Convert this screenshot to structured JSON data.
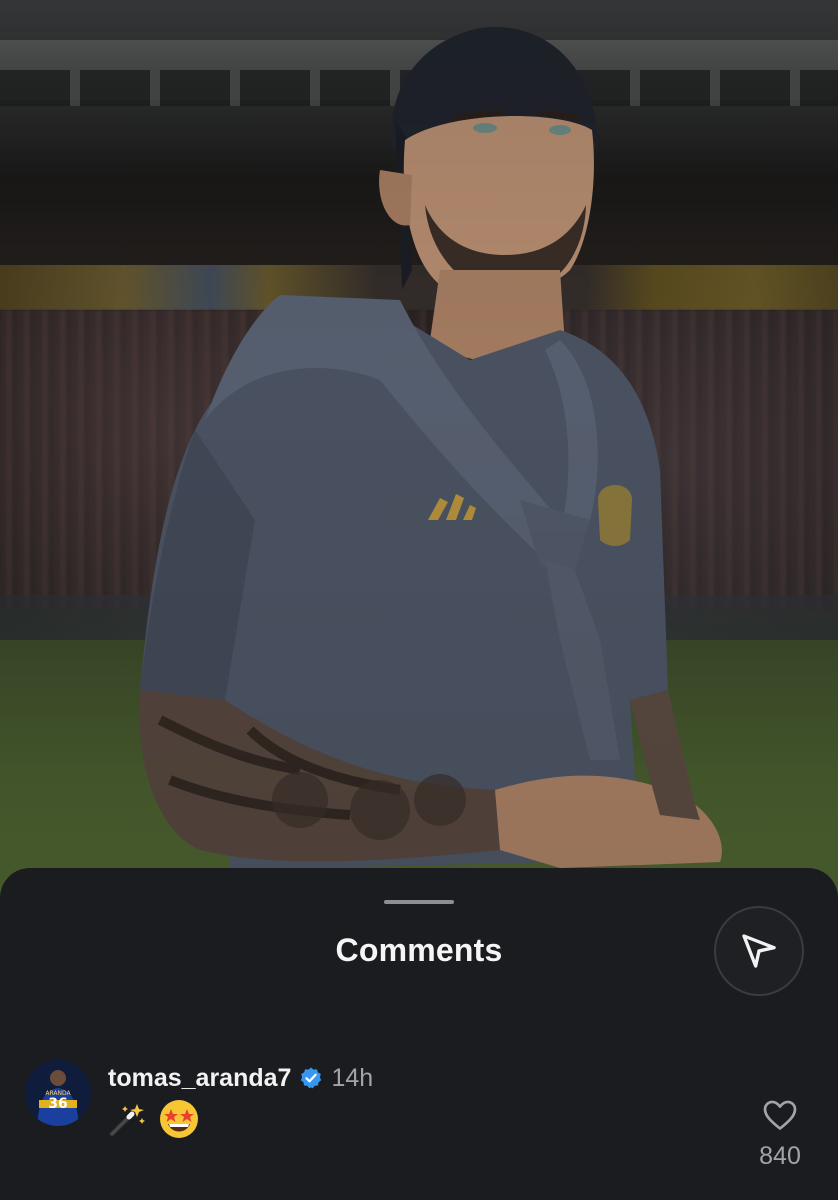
{
  "comments_sheet": {
    "title": "Comments",
    "share_icon": "send-paper-plane-icon"
  },
  "comment": {
    "username": "tomas_aranda7",
    "verified": true,
    "timestamp": "14h",
    "text_emojis": [
      "magic-wand-emoji",
      "star-struck-emoji"
    ],
    "like_icon": "heart-outline-icon",
    "like_count": "840",
    "avatar_jersey_name": "ARANDA",
    "avatar_jersey_number": "36"
  },
  "colors": {
    "sheet_bg": "#1b1c20",
    "text_primary": "#f2f2f2",
    "text_secondary": "#a3a4a8",
    "verified_blue": "#3797f0"
  }
}
